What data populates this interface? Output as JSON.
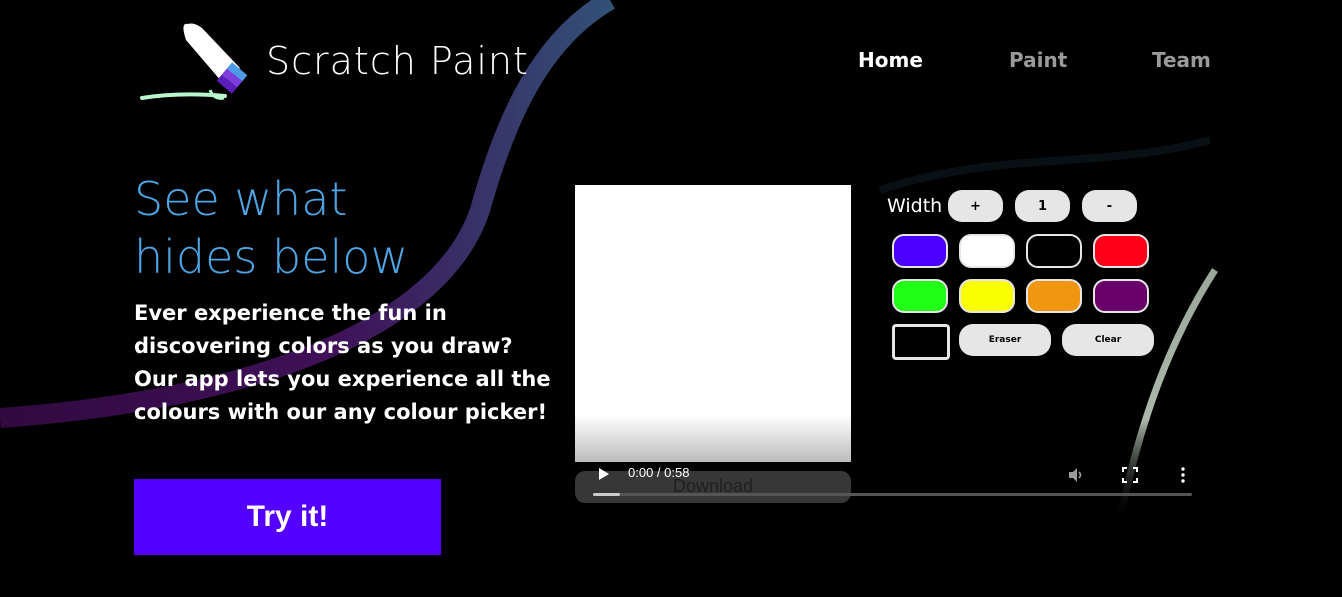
{
  "brand": {
    "name": "Scratch Paint"
  },
  "nav": {
    "home": "Home",
    "paint": "Paint",
    "team": "Team"
  },
  "hero": {
    "headline_line1": "See what",
    "headline_line2": "hides below",
    "body": "Ever experience the fun in discovering colors as you draw? Our app lets you experience all the colours with our any colour picker!",
    "cta": "Try it!"
  },
  "toolbar": {
    "width_label": "Width",
    "plus": "+",
    "width_value": "1",
    "minus": "-",
    "eraser": "Eraser",
    "clear": "Clear"
  },
  "swatches": [
    {
      "name": "blue",
      "color": "#4b00ff"
    },
    {
      "name": "white",
      "color": "#ffffff"
    },
    {
      "name": "black",
      "color": "#000000"
    },
    {
      "name": "red",
      "color": "#ff0019"
    },
    {
      "name": "green",
      "color": "#22ff16"
    },
    {
      "name": "yellow",
      "color": "#f9ff00"
    },
    {
      "name": "orange",
      "color": "#f0960f"
    },
    {
      "name": "purple",
      "color": "#690069"
    },
    {
      "name": "black-square",
      "color": "#000000"
    }
  ],
  "video": {
    "time": "0:00 / 0:58",
    "download": "Download",
    "progress": 0.045
  },
  "colors": {
    "accent": "#5400ff",
    "headline": "#4da6e6",
    "nav_inactive": "#9a9a9a"
  },
  "icons": [
    "brush-logo-icon",
    "play-icon",
    "volume-icon",
    "fullscreen-icon",
    "more-options-icon"
  ]
}
